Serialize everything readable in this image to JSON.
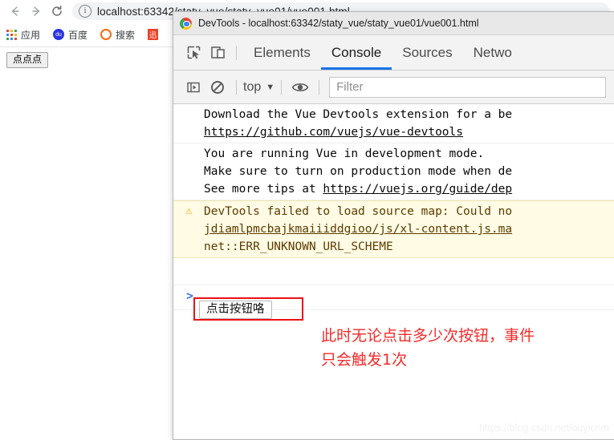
{
  "browser": {
    "nav": {
      "back_label": "←",
      "forward_label": "→",
      "reload_label": "⟳"
    },
    "omnibox": {
      "info_icon_label": "i",
      "url": "localhost:63342/staty_vue/staty_vue01/vue001.html"
    },
    "bookmarks": [
      {
        "icon": "apps-grid-icon",
        "label": "应用"
      },
      {
        "icon": "baidu-icon",
        "label": "百度"
      },
      {
        "icon": "so-icon",
        "label": "搜索"
      },
      {
        "icon": "misc-extension-icon",
        "label": ""
      }
    ],
    "page": {
      "button_label": "点点点"
    }
  },
  "devtools": {
    "title": "DevTools - localhost:63342/staty_vue/staty_vue01/vue001.html",
    "tabs": [
      {
        "label": "Elements",
        "active": false
      },
      {
        "label": "Console",
        "active": true
      },
      {
        "label": "Sources",
        "active": false
      },
      {
        "label": "Netwo",
        "active": false
      }
    ],
    "toolbar": {
      "context_label": "top",
      "context_caret": "▼",
      "filter_placeholder": "Filter",
      "filter_value": ""
    },
    "console": {
      "messages": [
        {
          "type": "log",
          "lines": [
            {
              "text": "Download the Vue Devtools extension for a be",
              "link": false
            },
            {
              "text": "https://github.com/vuejs/vue-devtools",
              "link": true
            }
          ]
        },
        {
          "type": "log",
          "lines": [
            {
              "text": "You are running Vue in development mode.",
              "link": false
            },
            {
              "text": "Make sure to turn on production mode when de",
              "link": false
            },
            {
              "text": "See more tips at ",
              "link": false,
              "suffix": "https://vuejs.org/guide/dep",
              "suffix_link": true
            }
          ]
        },
        {
          "type": "warning",
          "icon": "warning-triangle-icon",
          "lines": [
            {
              "text": "DevTools failed to load source map: Could no",
              "link": false
            },
            {
              "text": "jdiamlpmcbajkmaiiiddgioo/js/xl-content.js.ma",
              "link": true
            },
            {
              "text": "net::ERR_UNKNOWN_URL_SCHEME",
              "link": false
            }
          ]
        }
      ],
      "prompt_caret": ">"
    }
  },
  "annotations": {
    "demo_button_label": "点击按钮咯",
    "note_text": "此时无论点击多少次按钮，事件\n只会触发1次",
    "note_color": "#f42a2a",
    "box_color": "#ee1111"
  },
  "watermark": "https://blog.csdn.net/ouyicnm"
}
